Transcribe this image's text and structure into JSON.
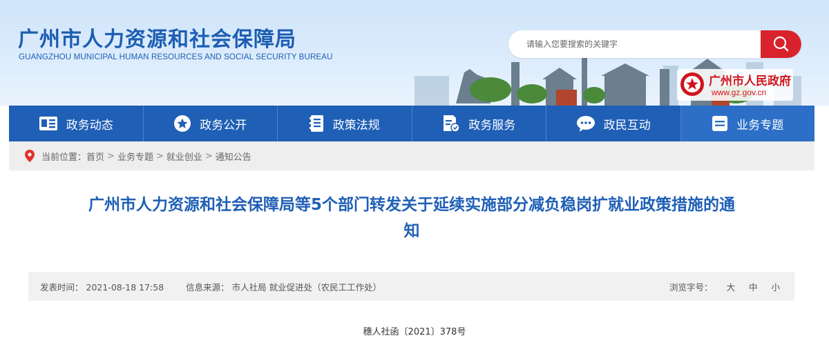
{
  "header": {
    "title_cn": "广州市人力资源和社会保障局",
    "title_en": "GUANGZHOU MUNICIPAL HUMAN RESOURCES AND SOCIAL SECURITY BUREAU",
    "search": {
      "placeholder": "请输入您要搜索的关键字"
    },
    "gov_badge": {
      "name": "广州市人民政府",
      "url": "www.gz.gov.cn"
    }
  },
  "nav": {
    "items": [
      {
        "label": "政务动态",
        "icon": "news-icon"
      },
      {
        "label": "政务公开",
        "icon": "star-icon"
      },
      {
        "label": "政策法规",
        "icon": "document-icon"
      },
      {
        "label": "政务服务",
        "icon": "service-icon"
      },
      {
        "label": "政民互动",
        "icon": "chat-icon"
      },
      {
        "label": "业务专题",
        "icon": "topic-icon"
      }
    ]
  },
  "breadcrumb": {
    "prefix": "当前位置：",
    "items": [
      "首页",
      "业务专题",
      "就业创业",
      "通知公告"
    ],
    "separator": ">"
  },
  "article": {
    "title_line1": "广州市人力资源和社会保障局等5个部门转发关于延续实施部分减负稳岗扩就业政策措施的通",
    "title_line2": "知",
    "publish_label": "发表时间：",
    "publish_time": "2021-08-18 17:58",
    "source_label": "信息来源：",
    "source": "市人社局 就业促进处（农民工工作处）",
    "font_size_label": "浏览字号：",
    "font_sizes": [
      "大",
      "中",
      "小"
    ],
    "doc_number": "穗人社函〔2021〕378号"
  },
  "colors": {
    "brand_blue": "#1f5fb6",
    "search_red": "#d9232c",
    "gov_red": "#d0141d"
  }
}
